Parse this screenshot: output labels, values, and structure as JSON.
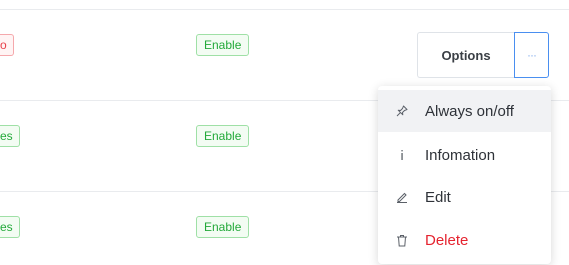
{
  "table": {
    "rows": [
      {
        "status_badge": "o",
        "enable_badge": "Enable"
      },
      {
        "status_badge": "es",
        "enable_badge": "Enable"
      },
      {
        "status_badge": "es",
        "enable_badge": "Enable"
      }
    ]
  },
  "actions": {
    "options_label": "Options",
    "more_label": "···"
  },
  "menu": {
    "items": [
      {
        "label": "Always on/off",
        "icon": "pin-icon"
      },
      {
        "label": "Infomation",
        "icon": "info-icon"
      },
      {
        "label": "Edit",
        "icon": "pencil-icon"
      },
      {
        "label": "Delete",
        "icon": "trash-icon"
      }
    ]
  },
  "colors": {
    "accent": "#4a8ff0",
    "success": "#23a93a",
    "danger": "#e5232f"
  }
}
